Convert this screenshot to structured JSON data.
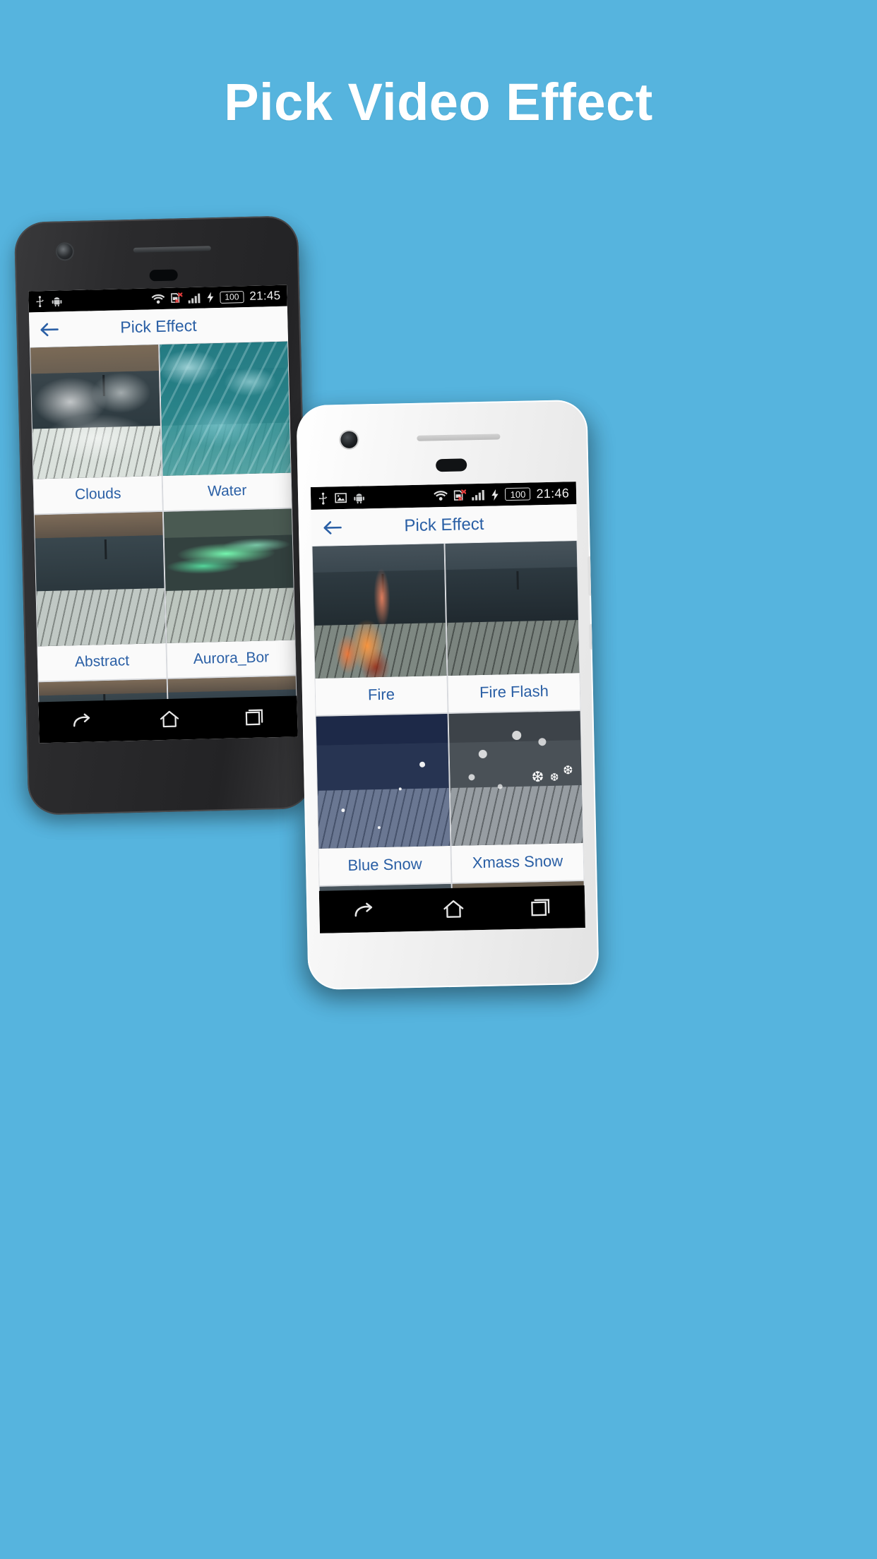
{
  "page": {
    "headline": "Pick Video Effect",
    "background_color": "#56b4de",
    "accent_color": "#2a5fa5"
  },
  "phone_back": {
    "device_label": "android-phone-dark",
    "frame_color": "#2b2b2d",
    "statusbar": {
      "time": "21:45",
      "battery_level": "100",
      "icons_left": [
        "usb-icon",
        "android-icon"
      ],
      "icons_right": [
        "wifi-icon",
        "sim-card-error-icon",
        "signal-bars-icon",
        "charging-bolt-icon",
        "battery-icon"
      ]
    },
    "toolbar": {
      "back_label": "back-arrow",
      "title": "Pick Effect"
    },
    "grid": [
      {
        "label": "Clouds",
        "effect": "clouds"
      },
      {
        "label": "Water",
        "effect": "water"
      },
      {
        "label": "Abstract",
        "effect": "abstract"
      },
      {
        "label": "Aurora_Bor",
        "effect": "aurora"
      },
      {
        "label": "",
        "effect": "plain"
      },
      {
        "label": "",
        "effect": "plain2"
      }
    ],
    "navbar": [
      "back-nav-icon",
      "home-nav-icon",
      "recents-nav-icon"
    ]
  },
  "phone_front": {
    "device_label": "android-phone-white",
    "frame_color": "#f4f4f4",
    "statusbar": {
      "time": "21:46",
      "battery_level": "100",
      "icons_left": [
        "usb-icon",
        "image-icon",
        "android-icon"
      ],
      "icons_right": [
        "wifi-icon",
        "sim-card-error-icon",
        "signal-bars-icon",
        "charging-bolt-icon",
        "battery-icon"
      ]
    },
    "toolbar": {
      "back_label": "back-arrow",
      "title": "Pick Effect"
    },
    "grid": [
      {
        "label": "Fire",
        "effect": "fire"
      },
      {
        "label": "Fire Flash",
        "effect": "fireflash"
      },
      {
        "label": "Blue Snow",
        "effect": "bluesnow"
      },
      {
        "label": "Xmass Snow",
        "effect": "xmasssnow"
      },
      {
        "label": "",
        "effect": "plain"
      },
      {
        "label": "",
        "effect": "plain2"
      }
    ],
    "navbar": [
      "back-nav-icon",
      "home-nav-icon",
      "recents-nav-icon"
    ]
  }
}
